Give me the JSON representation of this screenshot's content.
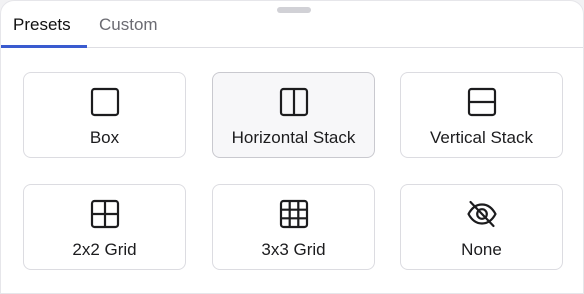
{
  "tabs": [
    {
      "label": "Presets",
      "active": true
    },
    {
      "label": "Custom",
      "active": false
    }
  ],
  "presets": [
    {
      "label": "Box",
      "icon": "box-icon",
      "selected": false
    },
    {
      "label": "Horizontal Stack",
      "icon": "horizontal-stack-icon",
      "selected": true
    },
    {
      "label": "Vertical Stack",
      "icon": "vertical-stack-icon",
      "selected": false
    },
    {
      "label": "2x2 Grid",
      "icon": "grid-2x2-icon",
      "selected": false
    },
    {
      "label": "3x3 Grid",
      "icon": "grid-3x3-icon",
      "selected": false
    },
    {
      "label": "None",
      "icon": "eye-slash-icon",
      "selected": false
    }
  ],
  "colors": {
    "accent": "#3a5bcf",
    "icon_stroke": "#1c1c1e",
    "tile_border": "#dcdce1"
  }
}
